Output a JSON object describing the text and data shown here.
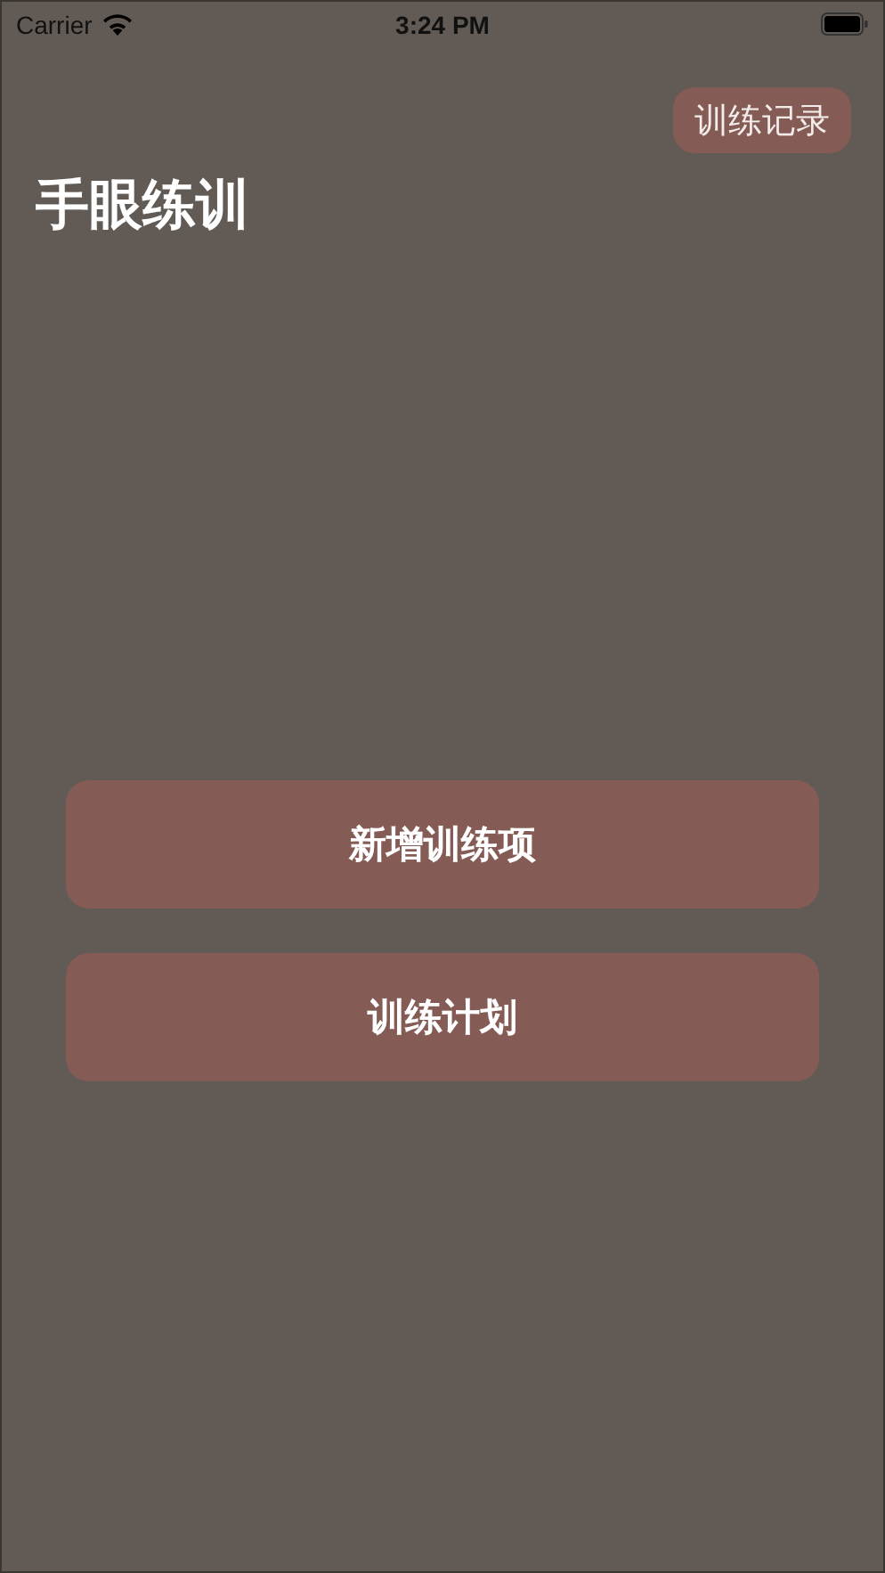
{
  "status_bar": {
    "carrier": "Carrier",
    "time": "3:24 PM"
  },
  "nav": {
    "record_button": "训练记录",
    "title": "手眼练训"
  },
  "actions": [
    "新增训练项",
    "训练计划"
  ]
}
